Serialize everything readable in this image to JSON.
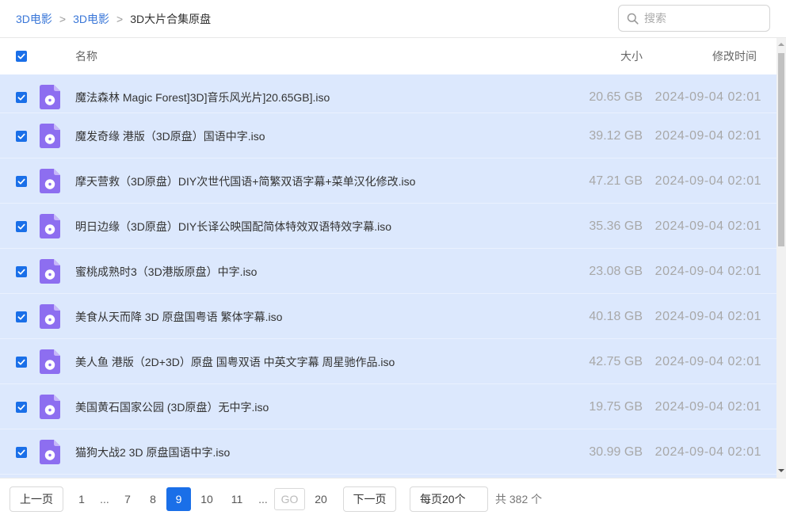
{
  "breadcrumb": {
    "items": [
      {
        "label": "3D电影"
      },
      {
        "label": "3D电影"
      },
      {
        "label": "3D大片合集原盘"
      }
    ],
    "separator": ">"
  },
  "search": {
    "placeholder": "搜索",
    "icon": "search-icon"
  },
  "table": {
    "select_all_checked": true,
    "headers": {
      "name": "名称",
      "size": "大小",
      "modified": "修改时间"
    },
    "rows": [
      {
        "name": "魔法森林 Magic Forest]3D]音乐风光片]20.65GB].iso",
        "size": "20.65 GB",
        "modified": "2024-09-04 02:01",
        "checked": true,
        "icon": "iso-file-icon"
      },
      {
        "name": "魔发奇缘 港版（3D原盘）国语中字.iso",
        "size": "39.12 GB",
        "modified": "2024-09-04 02:01",
        "checked": true,
        "icon": "iso-file-icon"
      },
      {
        "name": "摩天营救（3D原盘）DIY次世代国语+简繁双语字幕+菜单汉化修改.iso",
        "size": "47.21 GB",
        "modified": "2024-09-04 02:01",
        "checked": true,
        "icon": "iso-file-icon"
      },
      {
        "name": "明日边缘（3D原盘）DIY长译公映国配简体特效双语特效字幕.iso",
        "size": "35.36 GB",
        "modified": "2024-09-04 02:01",
        "checked": true,
        "icon": "iso-file-icon"
      },
      {
        "name": "蜜桃成熟时3（3D港版原盘）中字.iso",
        "size": "23.08 GB",
        "modified": "2024-09-04 02:01",
        "checked": true,
        "icon": "iso-file-icon"
      },
      {
        "name": "美食从天而降 3D 原盘国粤语 繁体字幕.iso",
        "size": "40.18 GB",
        "modified": "2024-09-04 02:01",
        "checked": true,
        "icon": "iso-file-icon"
      },
      {
        "name": "美人鱼 港版（2D+3D）原盘 国粤双语 中英文字幕 周星驰作品.iso",
        "size": "42.75 GB",
        "modified": "2024-09-04 02:01",
        "checked": true,
        "icon": "iso-file-icon"
      },
      {
        "name": "美国黄石国家公园 (3D原盘）无中字.iso",
        "size": "19.75 GB",
        "modified": "2024-09-04 02:01",
        "checked": true,
        "icon": "iso-file-icon"
      },
      {
        "name": "猫狗大战2 3D 原盘国语中字.iso",
        "size": "30.99 GB",
        "modified": "2024-09-04 02:01",
        "checked": true,
        "icon": "iso-file-icon"
      }
    ]
  },
  "pagination": {
    "prev_label": "上一页",
    "next_label": "下一页",
    "items": [
      {
        "label": "1"
      },
      {
        "label": "..."
      },
      {
        "label": "7"
      },
      {
        "label": "8"
      },
      {
        "label": "9",
        "current": true
      },
      {
        "label": "10"
      },
      {
        "label": "11"
      },
      {
        "label": "..."
      },
      {
        "label": "20"
      }
    ],
    "goto_placeholder": "GO",
    "page_size_label": "每页20个",
    "total_text": "共 382 个"
  },
  "colors": {
    "accent": "#1a6fe8",
    "selected_row_bg": "#dce8fd",
    "link": "#3a77d8",
    "icon_purple": "#8d6ef0"
  }
}
